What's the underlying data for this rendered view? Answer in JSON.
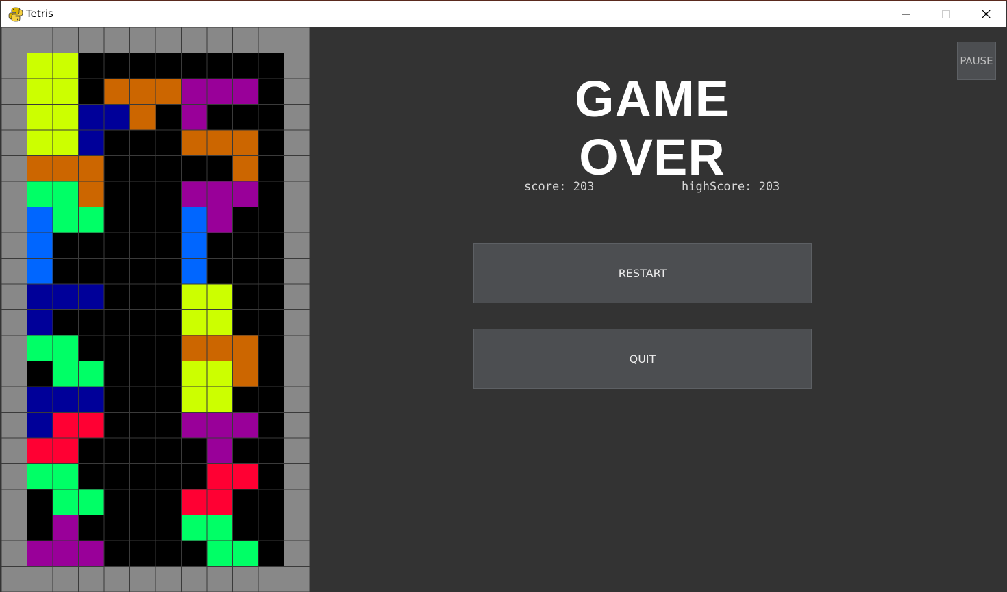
{
  "window": {
    "title": "Tetris",
    "app_icon": "python-icon",
    "controls": [
      "minimize-icon",
      "maximize-icon",
      "close-icon"
    ]
  },
  "game": {
    "status_text": "GAME OVER",
    "score_text": "score: 203",
    "high_score_text": "highScore: 203",
    "pause_label": "PAUSE",
    "restart_label": "RESTART",
    "quit_label": "QUIT"
  },
  "colors": {
    "wall": "#888888",
    "empty": "#000000",
    "grid_line": "#3a3a3a",
    "panel_bg": "#333333",
    "Y": "#ccff00",
    "O": "#cc6600",
    "P": "#990099",
    "N": "#000099",
    "B": "#0066ff",
    "G": "#00ff66",
    "R": "#ff0033"
  },
  "board": {
    "columns": 10,
    "rows": 20,
    "cells": [
      "YY........",
      "YY.OOOPPP.",
      "YYNNO.P...",
      "YYN...OOO.",
      "OOO.....O.",
      "GGO...PPP.",
      "BGG...BP..",
      "B.....B...",
      "B.....B...",
      "NNN...YY..",
      "N.....YY..",
      "GG....OOO.",
      ".GG...YYO.",
      "NNN...YY..",
      "NRR...PPP.",
      "RR.....P..",
      "GG.....RR.",
      ".GG...RR..",
      ".P....GG..",
      "PPP....GG."
    ]
  }
}
